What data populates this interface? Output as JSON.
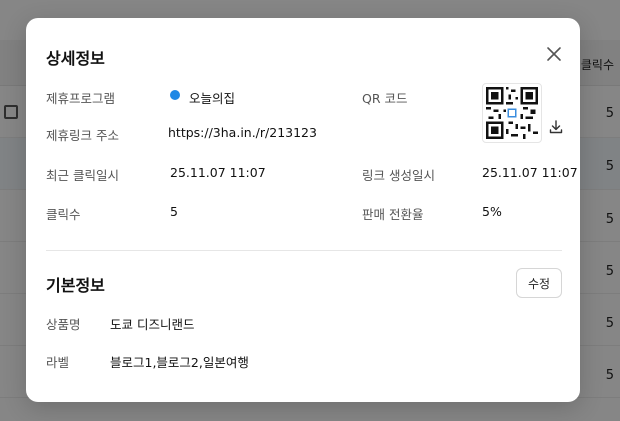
{
  "background": {
    "column_header": "클릭수",
    "row_values": [
      "5",
      "5",
      "5",
      "5",
      "5",
      "5"
    ]
  },
  "modal": {
    "title": "상세정보",
    "close_icon": "close-icon",
    "details": {
      "program_label": "제휴프로그램",
      "program_value": "오늘의집",
      "program_dot_color": "#1e88e5",
      "link_label": "제휴링크 주소",
      "link_value": "https://3ha.in./r/213123",
      "qr_label": "QR 코드",
      "recent_click_label": "최근 클릭일시",
      "recent_click_value": "25.11.07 11:07",
      "created_label": "링크 생성일시",
      "created_value": "25.11.07 11:07",
      "clicks_label": "클릭수",
      "clicks_value": "5",
      "conversion_label": "판매 전환율",
      "conversion_value": "5%"
    },
    "basic": {
      "title": "기본정보",
      "edit_label": "수정",
      "product_label": "상품명",
      "product_value": "도쿄 디즈니랜드",
      "tag_label": "라벨",
      "tag_value": "블로그1,블로그2,일본여행"
    }
  }
}
